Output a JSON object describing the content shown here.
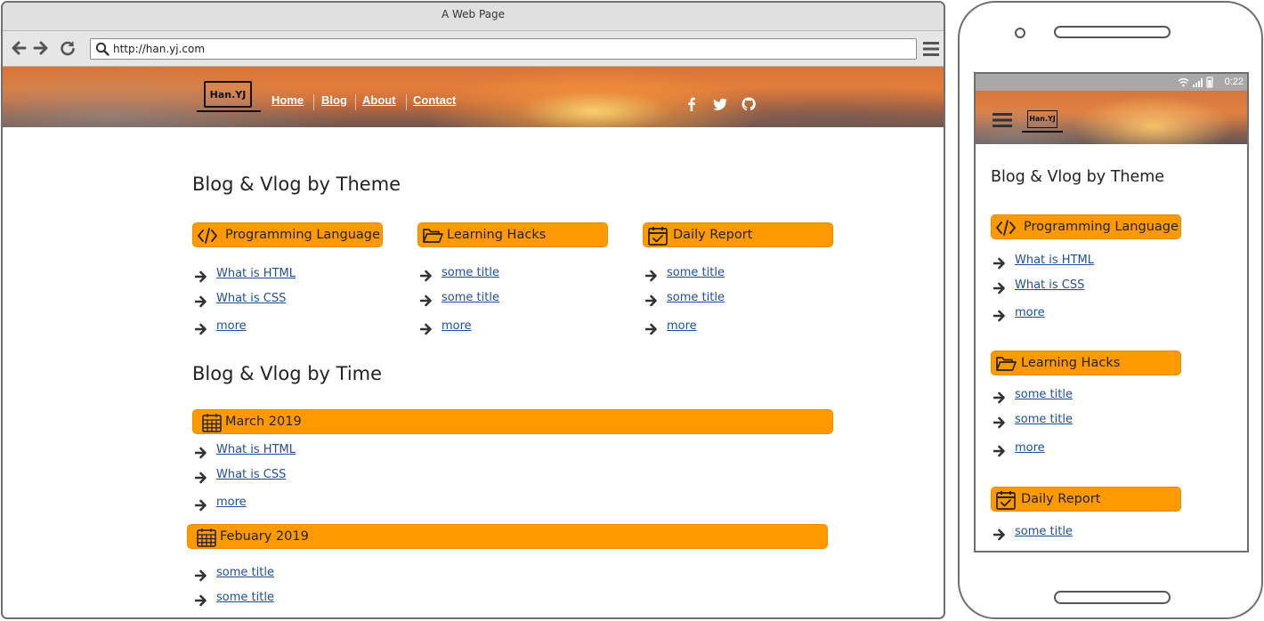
{
  "browser": {
    "title": "A Web Page",
    "url": "http://han.yj.com"
  },
  "site": {
    "logo_text": "Han.YJ",
    "nav": [
      "Home",
      "Blog",
      "About",
      "Contact"
    ],
    "social_icons": [
      "facebook-icon",
      "twitter-icon",
      "github-icon"
    ]
  },
  "theme_section": {
    "heading": "Blog & Vlog by Theme",
    "categories": [
      {
        "label": "Programming Language",
        "icon": "code-icon",
        "items": [
          "What is HTML",
          "What is CSS",
          "more"
        ]
      },
      {
        "label": "Learning Hacks",
        "icon": "folder-open-icon",
        "items": [
          "some title",
          "some title",
          "more"
        ]
      },
      {
        "label": "Daily Report",
        "icon": "calendar-check-icon",
        "items": [
          "some title",
          "some title",
          "more"
        ]
      }
    ]
  },
  "time_section": {
    "heading": "Blog & Vlog by Time",
    "months": [
      {
        "label": "March 2019",
        "icon": "calendar-icon",
        "items": [
          "What is HTML",
          "What is CSS",
          "more"
        ]
      },
      {
        "label": "Febuary 2019",
        "icon": "calendar-icon",
        "items": [
          "some title",
          "some title"
        ]
      }
    ]
  },
  "mobile": {
    "status_time": "0:22",
    "logo_text": "Han.YJ",
    "heading": "Blog & Vlog by Theme",
    "categories": [
      {
        "label": "Programming Language",
        "icon": "code-icon",
        "items": [
          "What is HTML",
          "What is CSS",
          "more"
        ]
      },
      {
        "label": "Learning Hacks",
        "icon": "folder-open-icon",
        "items": [
          "some title",
          "some title",
          "more"
        ]
      },
      {
        "label": "Daily Report",
        "icon": "calendar-check-icon",
        "items": [
          "some title"
        ]
      }
    ]
  },
  "colors": {
    "accent": "#ff9900",
    "link": "#1f4f9a",
    "text": "#222222"
  }
}
